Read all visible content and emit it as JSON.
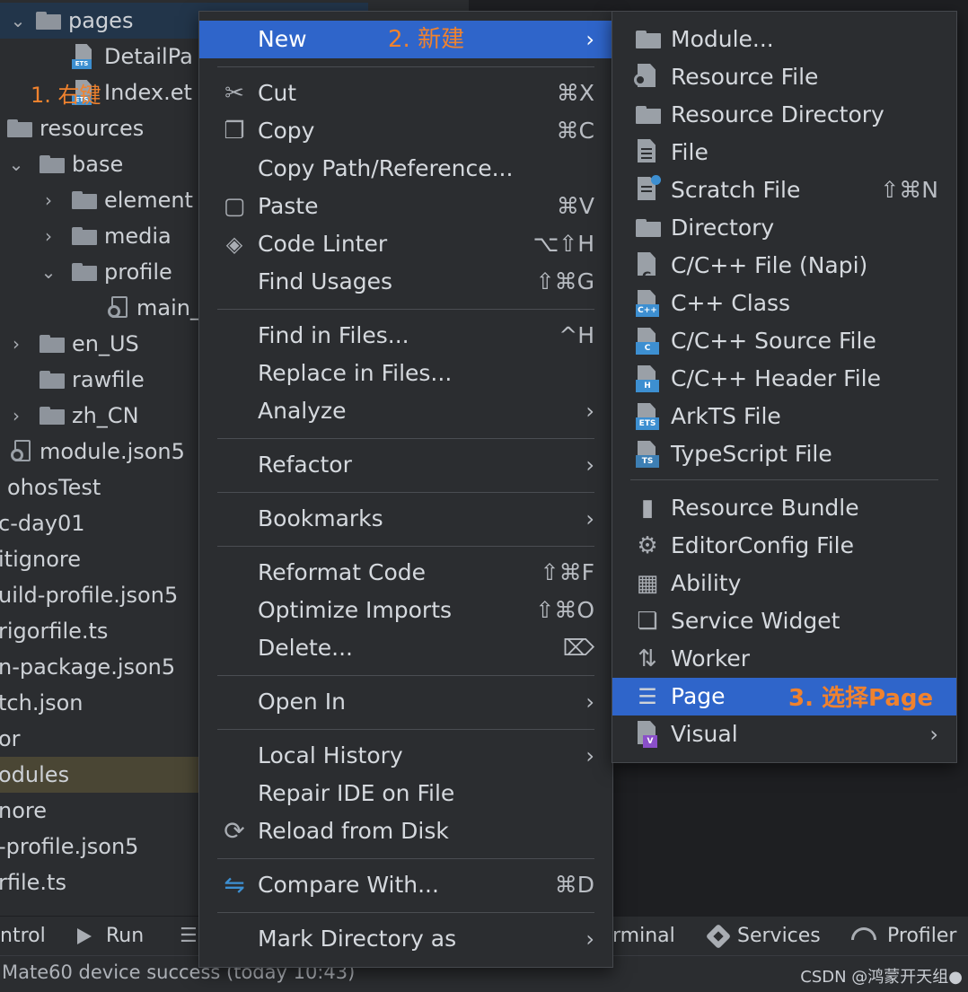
{
  "project_tree": {
    "items": [
      {
        "label": "pages",
        "arrow": "⌄",
        "kind": "folder",
        "selected": true
      },
      {
        "label": "DetailPa",
        "kind": "ets-file"
      },
      {
        "label": "Index.et",
        "kind": "ets-file"
      },
      {
        "label": "resources",
        "kind": "folder"
      },
      {
        "label": "base",
        "arrow": "⌄",
        "kind": "folder"
      },
      {
        "label": "element",
        "arrow": "›",
        "kind": "folder"
      },
      {
        "label": "media",
        "arrow": "›",
        "kind": "folder"
      },
      {
        "label": "profile",
        "arrow": "⌄",
        "kind": "folder"
      },
      {
        "label": "main_",
        "kind": "json-file"
      },
      {
        "label": "en_US",
        "arrow": "›",
        "kind": "folder"
      },
      {
        "label": "rawfile",
        "kind": "folder"
      },
      {
        "label": "zh_CN",
        "arrow": "›",
        "kind": "folder"
      },
      {
        "label": "module.json5",
        "kind": "json-file"
      },
      {
        "label": "ohosTest"
      },
      {
        "label": "c-day01"
      },
      {
        "label": "itignore"
      },
      {
        "label": "uild-profile.json5"
      },
      {
        "label": "rigorfile.ts"
      },
      {
        "label": "n-package.json5"
      },
      {
        "label": "tch.json"
      },
      {
        "label": "or"
      },
      {
        "label": "odules",
        "highlighted": true
      },
      {
        "label": "nore"
      },
      {
        "label": "-profile.json5"
      },
      {
        "label": "rfile.ts"
      }
    ],
    "annotation": "1. 右键"
  },
  "context_menu": {
    "items": [
      {
        "label": "New",
        "selected": true,
        "submenu": true,
        "note": "2. 新建"
      },
      {
        "sep": true
      },
      {
        "label": "Cut",
        "shortcut": "⌘X",
        "icon": "scissors-icon"
      },
      {
        "label": "Copy",
        "shortcut": "⌘C",
        "icon": "copy-icon"
      },
      {
        "label": "Copy Path/Reference..."
      },
      {
        "label": "Paste",
        "shortcut": "⌘V",
        "icon": "clipboard-icon"
      },
      {
        "label": "Code Linter",
        "shortcut": "⌥⇧H",
        "icon": "linter-icon"
      },
      {
        "label": "Find Usages",
        "shortcut": "⇧⌘G"
      },
      {
        "sep": true
      },
      {
        "label": "Find in Files...",
        "shortcut": "^H"
      },
      {
        "label": "Replace in Files..."
      },
      {
        "label": "Analyze",
        "submenu": true
      },
      {
        "sep": true
      },
      {
        "label": "Refactor",
        "submenu": true
      },
      {
        "sep": true
      },
      {
        "label": "Bookmarks",
        "submenu": true
      },
      {
        "sep": true
      },
      {
        "label": "Reformat Code",
        "shortcut": "⇧⌘F"
      },
      {
        "label": "Optimize Imports",
        "shortcut": "⇧⌘O"
      },
      {
        "label": "Delete...",
        "shortcut": "⌦"
      },
      {
        "sep": true
      },
      {
        "label": "Open In",
        "submenu": true
      },
      {
        "sep": true
      },
      {
        "label": "Local History",
        "submenu": true
      },
      {
        "label": "Repair IDE on File"
      },
      {
        "label": "Reload from Disk",
        "icon": "reload-icon"
      },
      {
        "sep": true
      },
      {
        "label": "Compare With...",
        "shortcut": "⌘D",
        "icon": "compare-icon"
      },
      {
        "sep": true
      },
      {
        "label": "Mark Directory as",
        "submenu": true
      }
    ]
  },
  "new_submenu": {
    "items": [
      {
        "label": "Module...",
        "icon": "module-folder-icon"
      },
      {
        "label": "Resource File",
        "icon": "resource-file-icon"
      },
      {
        "label": "Resource Directory",
        "icon": "folder-icon"
      },
      {
        "label": "File",
        "icon": "file-icon"
      },
      {
        "label": "Scratch File",
        "shortcut": "⇧⌘N",
        "icon": "scratch-file-icon"
      },
      {
        "label": "Directory",
        "icon": "folder-icon"
      },
      {
        "label": "C/C++ File (Napi)",
        "icon": "c-file-icon"
      },
      {
        "label": "C++ Class",
        "icon": "cpp-class-icon",
        "tag": "C++"
      },
      {
        "label": "C/C++ Source File",
        "icon": "c-source-icon",
        "tag": "C"
      },
      {
        "label": "C/C++ Header File",
        "icon": "c-header-icon",
        "tag": "H"
      },
      {
        "label": "ArkTS File",
        "icon": "arkts-file-icon",
        "tag": "ETS"
      },
      {
        "label": "TypeScript File",
        "icon": "typescript-file-icon",
        "tag": "TS"
      },
      {
        "sep": true
      },
      {
        "label": "Resource Bundle",
        "icon": "resource-bundle-icon"
      },
      {
        "label": "EditorConfig File",
        "icon": "gear-icon"
      },
      {
        "label": "Ability",
        "icon": "ability-icon"
      },
      {
        "label": "Service Widget",
        "icon": "widget-icon"
      },
      {
        "label": "Worker",
        "icon": "worker-icon"
      },
      {
        "label": "Page",
        "selected": true,
        "icon": "page-list-icon",
        "note": "3. 选择Page"
      },
      {
        "label": "Visual",
        "submenu": true,
        "icon": "visual-icon"
      }
    ]
  },
  "toolbar": {
    "items": [
      {
        "label": "ntrol"
      },
      {
        "label": "Run",
        "icon": "run-icon"
      },
      {
        "label": "☰",
        "icon": "list-icon"
      },
      {
        "label": "rminal"
      },
      {
        "label": "Services",
        "icon": "services-icon"
      },
      {
        "label": "Profiler",
        "icon": "profiler-icon"
      }
    ]
  },
  "status_bar": {
    "message": "Mate60 device success (today 10:43)",
    "watermark": "CSDN @鸿蒙开天组●"
  },
  "colors": {
    "background": "#2b2d30",
    "selection": "#2f65ca",
    "annotation": "#f0822e"
  }
}
